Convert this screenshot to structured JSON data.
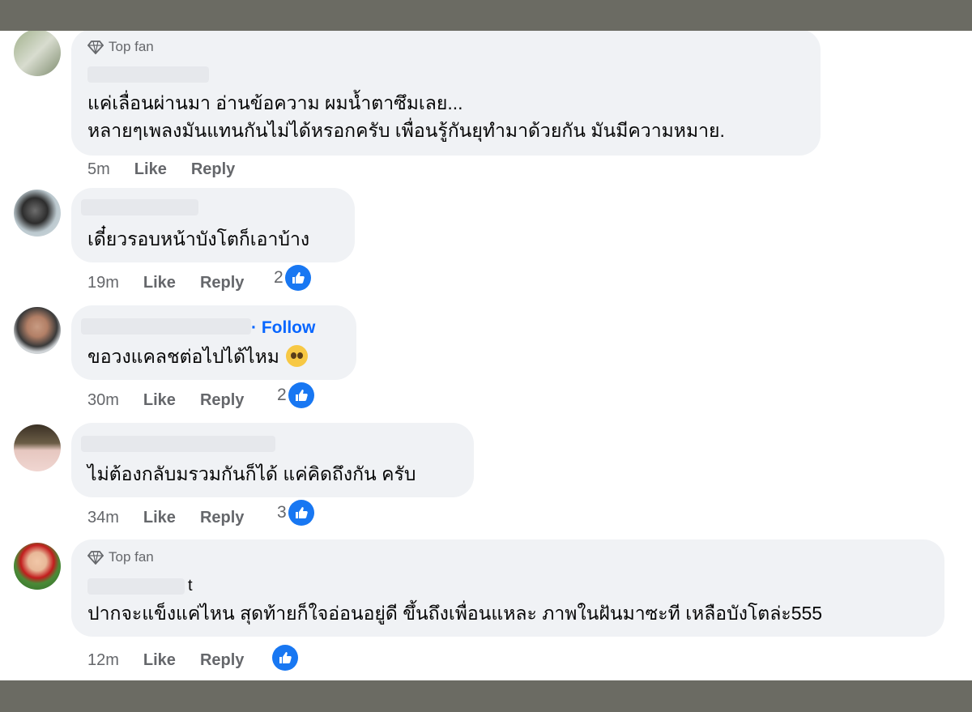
{
  "comments": [
    {
      "badge": "Top fan",
      "lines": [
        "แค่เลื่อนผ่านมา อ่านข้อความ ผมน้ำตาซึมเลย...",
        "หลายๆเพลงมันแทนกันไม่ได้หรอกครับ เพื่อนรู้กันยุทำมาด้วยกัน มันมีความหมาย."
      ],
      "time": "5m",
      "like": "Like",
      "reply": "Reply",
      "reactions": ""
    },
    {
      "lines": [
        "เดี๋ยวรอบหน้าบังโตก็เอาบ้าง"
      ],
      "time": "19m",
      "like": "Like",
      "reply": "Reply",
      "reactions": "2"
    },
    {
      "follow": "· Follow",
      "lines": [
        "ขอวงแคลชต่อไปได้ไหม"
      ],
      "emoji": "pleading-face",
      "time": "30m",
      "like": "Like",
      "reply": "Reply",
      "reactions": "2"
    },
    {
      "lines": [
        "ไม่ต้องกลับมรวมกันก็ได้ แค่คิดถึงกัน ครับ"
      ],
      "time": "34m",
      "like": "Like",
      "reply": "Reply",
      "reactions": "3"
    },
    {
      "badge": "Top fan",
      "name_fragment": "t",
      "lines": [
        "ปากจะแข็งแค่ไหน สุดท้ายก็ใจอ่อนอยู่ดี ขึ้นถึงเพื่อนแหละ ภาพในฝันมาซะที เหลือบังโตล่ะ555"
      ],
      "time": "12m",
      "like": "Like",
      "reply": "Reply",
      "reactions": ""
    }
  ],
  "icons": {
    "badge": "diamond-icon",
    "reaction": "thumbs-up-icon"
  },
  "colors": {
    "accent": "#1877f2",
    "bubble": "#f0f2f5",
    "frame": "#6b6b63"
  }
}
